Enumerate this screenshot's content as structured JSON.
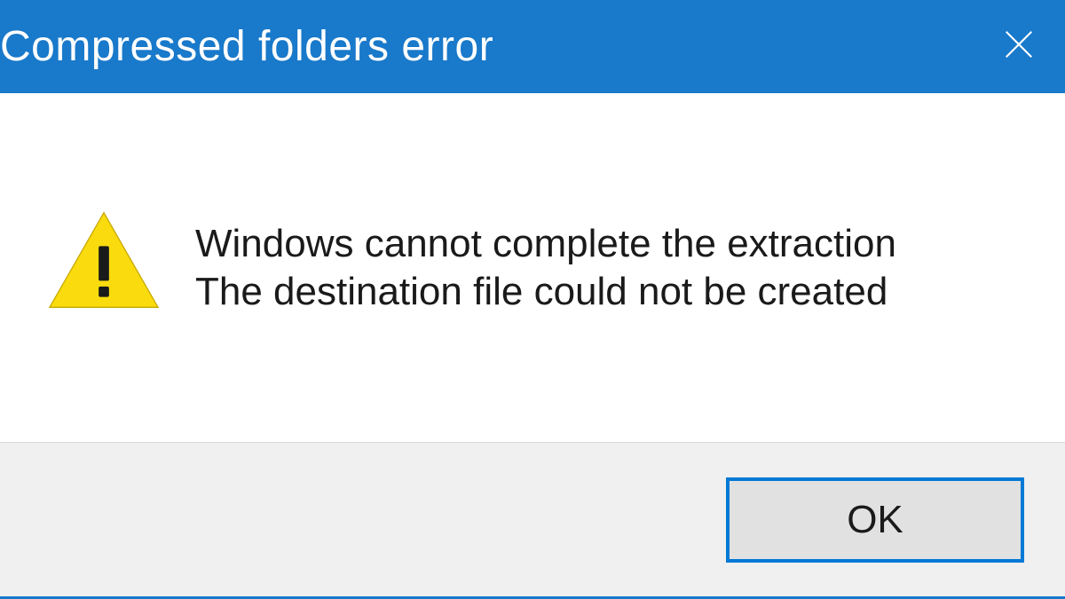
{
  "titlebar": {
    "title": "Compressed folders error"
  },
  "message": {
    "line1": "Windows cannot complete the extraction",
    "line2": "The destination file could not be created"
  },
  "footer": {
    "ok_label": "OK"
  },
  "colors": {
    "titlebar_bg": "#1979ca",
    "warning_fill": "#fadc0e",
    "button_border": "#0179d5"
  }
}
